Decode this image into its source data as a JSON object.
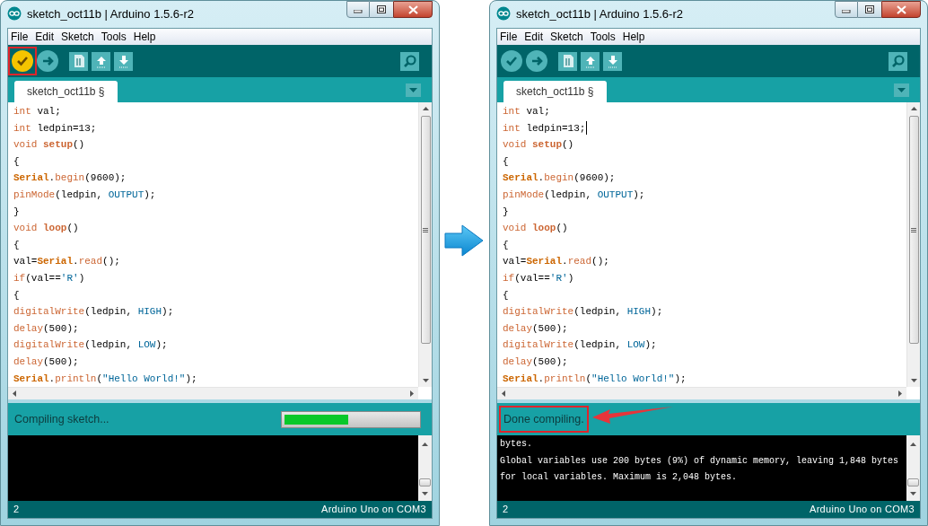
{
  "windows": [
    {
      "title": "sketch_oct11b | Arduino 1.5.6-r2",
      "menu": [
        "File",
        "Edit",
        "Sketch",
        "Tools",
        "Help"
      ],
      "toolbar": [
        {
          "kind": "verify",
          "active": true,
          "highlighted": true
        },
        {
          "kind": "upload",
          "active": false,
          "highlighted": false
        },
        {
          "kind": "new",
          "active": false,
          "highlighted": false
        },
        {
          "kind": "open",
          "active": false,
          "highlighted": false
        },
        {
          "kind": "save",
          "active": false,
          "highlighted": false
        },
        {
          "kind": "monitor",
          "active": false,
          "highlighted": false
        }
      ],
      "tabs": [
        {
          "label": "sketch_oct11b §",
          "selected": true
        }
      ],
      "code": [
        {
          "cursor": false,
          "tokens": [
            {
              "kind": "type",
              "text": "int"
            },
            {
              "kind": "text",
              "text": " val;"
            }
          ]
        },
        {
          "cursor": false,
          "tokens": [
            {
              "kind": "type",
              "text": "int"
            },
            {
              "kind": "text",
              "text": " ledpin=13;"
            }
          ]
        },
        {
          "cursor": false,
          "tokens": [
            {
              "kind": "type",
              "text": "void"
            },
            {
              "kind": "name",
              "text": " setup"
            },
            {
              "kind": "text",
              "text": "()"
            }
          ]
        },
        {
          "cursor": false,
          "tokens": [
            {
              "kind": "text",
              "text": "{"
            }
          ]
        },
        {
          "cursor": false,
          "tokens": [
            {
              "kind": "class",
              "text": "Serial"
            },
            {
              "kind": "text",
              "text": "."
            },
            {
              "kind": "func",
              "text": "begin"
            },
            {
              "kind": "text",
              "text": "(9600);"
            }
          ]
        },
        {
          "cursor": false,
          "tokens": [
            {
              "kind": "func",
              "text": "pinMode"
            },
            {
              "kind": "text",
              "text": "(ledpin, "
            },
            {
              "kind": "const",
              "text": "OUTPUT"
            },
            {
              "kind": "text",
              "text": ");"
            }
          ]
        },
        {
          "cursor": false,
          "tokens": [
            {
              "kind": "text",
              "text": "}"
            }
          ]
        },
        {
          "cursor": false,
          "tokens": [
            {
              "kind": "type",
              "text": "void"
            },
            {
              "kind": "name",
              "text": " loop"
            },
            {
              "kind": "text",
              "text": "()"
            }
          ]
        },
        {
          "cursor": false,
          "tokens": [
            {
              "kind": "text",
              "text": "{"
            }
          ]
        },
        {
          "cursor": false,
          "tokens": [
            {
              "kind": "text",
              "text": "val="
            },
            {
              "kind": "class",
              "text": "Serial"
            },
            {
              "kind": "text",
              "text": "."
            },
            {
              "kind": "func",
              "text": "read"
            },
            {
              "kind": "text",
              "text": "();"
            }
          ]
        },
        {
          "cursor": false,
          "tokens": [
            {
              "kind": "func",
              "text": "if"
            },
            {
              "kind": "text",
              "text": "(val=="
            },
            {
              "kind": "string",
              "text": "'R'"
            },
            {
              "kind": "text",
              "text": ")"
            }
          ]
        },
        {
          "cursor": false,
          "tokens": [
            {
              "kind": "text",
              "text": "{"
            }
          ]
        },
        {
          "cursor": false,
          "tokens": [
            {
              "kind": "func",
              "text": "digitalWrite"
            },
            {
              "kind": "text",
              "text": "(ledpin, "
            },
            {
              "kind": "const",
              "text": "HIGH"
            },
            {
              "kind": "text",
              "text": ");"
            }
          ]
        },
        {
          "cursor": false,
          "tokens": [
            {
              "kind": "func",
              "text": "delay"
            },
            {
              "kind": "text",
              "text": "(500);"
            }
          ]
        },
        {
          "cursor": false,
          "tokens": [
            {
              "kind": "func",
              "text": "digitalWrite"
            },
            {
              "kind": "text",
              "text": "(ledpin, "
            },
            {
              "kind": "const",
              "text": "LOW"
            },
            {
              "kind": "text",
              "text": ");"
            }
          ]
        },
        {
          "cursor": false,
          "tokens": [
            {
              "kind": "func",
              "text": "delay"
            },
            {
              "kind": "text",
              "text": "(500);"
            }
          ]
        },
        {
          "cursor": false,
          "tokens": [
            {
              "kind": "class",
              "text": "Serial"
            },
            {
              "kind": "text",
              "text": "."
            },
            {
              "kind": "func",
              "text": "println"
            },
            {
              "kind": "text",
              "text": "("
            },
            {
              "kind": "string",
              "text": "\"Hello World!\""
            },
            {
              "kind": "text",
              "text": ");"
            }
          ]
        }
      ],
      "status": {
        "message": "Compiling sketch...",
        "highlighted": false,
        "progress": {
          "level": 0.48
        }
      },
      "footer": {
        "line": "2",
        "board": "Arduino Uno on COM3"
      }
    },
    {
      "title": "sketch_oct11b | Arduino 1.5.6-r2",
      "menu": [
        "File",
        "Edit",
        "Sketch",
        "Tools",
        "Help"
      ],
      "toolbar": [
        {
          "kind": "verify",
          "active": false,
          "highlighted": false
        },
        {
          "kind": "upload",
          "active": false,
          "highlighted": false
        },
        {
          "kind": "new",
          "active": false,
          "highlighted": false
        },
        {
          "kind": "open",
          "active": false,
          "highlighted": false
        },
        {
          "kind": "save",
          "active": false,
          "highlighted": false
        },
        {
          "kind": "monitor",
          "active": false,
          "highlighted": false
        }
      ],
      "tabs": [
        {
          "label": "sketch_oct11b §",
          "selected": true
        }
      ],
      "code": [
        {
          "cursor": false,
          "tokens": [
            {
              "kind": "type",
              "text": "int"
            },
            {
              "kind": "text",
              "text": " val;"
            }
          ]
        },
        {
          "cursor": true,
          "tokens": [
            {
              "kind": "type",
              "text": "int"
            },
            {
              "kind": "text",
              "text": " ledpin=13;"
            }
          ]
        },
        {
          "cursor": false,
          "tokens": [
            {
              "kind": "type",
              "text": "void"
            },
            {
              "kind": "name",
              "text": " setup"
            },
            {
              "kind": "text",
              "text": "()"
            }
          ]
        },
        {
          "cursor": false,
          "tokens": [
            {
              "kind": "text",
              "text": "{"
            }
          ]
        },
        {
          "cursor": false,
          "tokens": [
            {
              "kind": "class",
              "text": "Serial"
            },
            {
              "kind": "text",
              "text": "."
            },
            {
              "kind": "func",
              "text": "begin"
            },
            {
              "kind": "text",
              "text": "(9600);"
            }
          ]
        },
        {
          "cursor": false,
          "tokens": [
            {
              "kind": "func",
              "text": "pinMode"
            },
            {
              "kind": "text",
              "text": "(ledpin, "
            },
            {
              "kind": "const",
              "text": "OUTPUT"
            },
            {
              "kind": "text",
              "text": ");"
            }
          ]
        },
        {
          "cursor": false,
          "tokens": [
            {
              "kind": "text",
              "text": "}"
            }
          ]
        },
        {
          "cursor": false,
          "tokens": [
            {
              "kind": "type",
              "text": "void"
            },
            {
              "kind": "name",
              "text": " loop"
            },
            {
              "kind": "text",
              "text": "()"
            }
          ]
        },
        {
          "cursor": false,
          "tokens": [
            {
              "kind": "text",
              "text": "{"
            }
          ]
        },
        {
          "cursor": false,
          "tokens": [
            {
              "kind": "text",
              "text": "val="
            },
            {
              "kind": "class",
              "text": "Serial"
            },
            {
              "kind": "text",
              "text": "."
            },
            {
              "kind": "func",
              "text": "read"
            },
            {
              "kind": "text",
              "text": "();"
            }
          ]
        },
        {
          "cursor": false,
          "tokens": [
            {
              "kind": "func",
              "text": "if"
            },
            {
              "kind": "text",
              "text": "(val=="
            },
            {
              "kind": "string",
              "text": "'R'"
            },
            {
              "kind": "text",
              "text": ")"
            }
          ]
        },
        {
          "cursor": false,
          "tokens": [
            {
              "kind": "text",
              "text": "{"
            }
          ]
        },
        {
          "cursor": false,
          "tokens": [
            {
              "kind": "func",
              "text": "digitalWrite"
            },
            {
              "kind": "text",
              "text": "(ledpin, "
            },
            {
              "kind": "const",
              "text": "HIGH"
            },
            {
              "kind": "text",
              "text": ");"
            }
          ]
        },
        {
          "cursor": false,
          "tokens": [
            {
              "kind": "func",
              "text": "delay"
            },
            {
              "kind": "text",
              "text": "(500);"
            }
          ]
        },
        {
          "cursor": false,
          "tokens": [
            {
              "kind": "func",
              "text": "digitalWrite"
            },
            {
              "kind": "text",
              "text": "(ledpin, "
            },
            {
              "kind": "const",
              "text": "LOW"
            },
            {
              "kind": "text",
              "text": ");"
            }
          ]
        },
        {
          "cursor": false,
          "tokens": [
            {
              "kind": "func",
              "text": "delay"
            },
            {
              "kind": "text",
              "text": "(500);"
            }
          ]
        },
        {
          "cursor": false,
          "tokens": [
            {
              "kind": "class",
              "text": "Serial"
            },
            {
              "kind": "text",
              "text": "."
            },
            {
              "kind": "func",
              "text": "println"
            },
            {
              "kind": "text",
              "text": "("
            },
            {
              "kind": "string",
              "text": "\"Hello World!\""
            },
            {
              "kind": "text",
              "text": ");"
            }
          ]
        }
      ],
      "status": {
        "message": "Done compiling.",
        "highlighted": true
      },
      "console": [
        "bytes.",
        "Global variables use 200 bytes (9%) of dynamic memory, leaving 1,848 bytes",
        "for local variables. Maximum is 2,048 bytes."
      ],
      "footer": {
        "line": "2",
        "board": "Arduino Uno on COM3"
      }
    }
  ]
}
